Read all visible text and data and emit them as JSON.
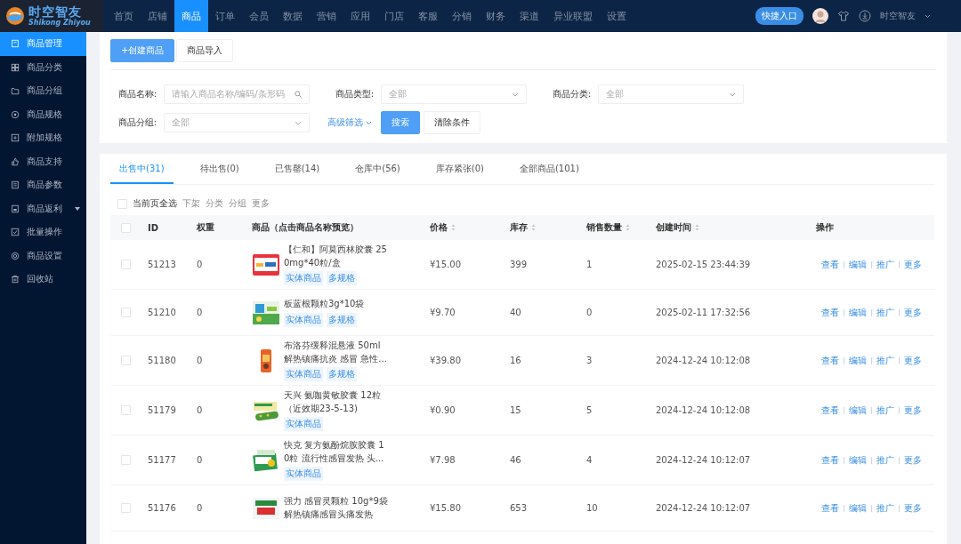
{
  "brand": {
    "name": "时空智友",
    "subtitle": "Shikong Zhiyou"
  },
  "nav": [
    {
      "label": "首页",
      "selected": false
    },
    {
      "label": "店铺",
      "selected": false
    },
    {
      "label": "商品",
      "selected": true
    },
    {
      "label": "订单",
      "selected": false
    },
    {
      "label": "会员",
      "selected": false
    },
    {
      "label": "数据",
      "selected": false
    },
    {
      "label": "营销",
      "selected": false
    },
    {
      "label": "应用",
      "selected": false
    },
    {
      "label": "门店",
      "selected": false
    },
    {
      "label": "客服",
      "selected": false
    },
    {
      "label": "分销",
      "selected": false
    },
    {
      "label": "财务",
      "selected": false
    },
    {
      "label": "渠道",
      "selected": false
    },
    {
      "label": "异业联盟",
      "selected": false
    },
    {
      "label": "设置",
      "selected": false
    }
  ],
  "header_right": {
    "quick_button": "快捷入口",
    "user": "时空智友"
  },
  "sidebar": [
    {
      "label": "商品管理",
      "selected": true,
      "has_submenu": false
    },
    {
      "label": "商品分类",
      "selected": false,
      "has_submenu": false
    },
    {
      "label": "商品分组",
      "selected": false,
      "has_submenu": false
    },
    {
      "label": "商品规格",
      "selected": false,
      "has_submenu": false
    },
    {
      "label": "附加规格",
      "selected": false,
      "has_submenu": false
    },
    {
      "label": "商品支持",
      "selected": false,
      "has_submenu": false
    },
    {
      "label": "商品参数",
      "selected": false,
      "has_submenu": false
    },
    {
      "label": "商品返利",
      "selected": false,
      "has_submenu": true
    },
    {
      "label": "批量操作",
      "selected": false,
      "has_submenu": false
    },
    {
      "label": "商品设置",
      "selected": false,
      "has_submenu": false
    },
    {
      "label": "回收站",
      "selected": false,
      "has_submenu": false
    }
  ],
  "toolbar": [
    {
      "label": "+创建商品",
      "kind": "primary"
    },
    {
      "label": "商品导入",
      "kind": "default"
    }
  ],
  "filters": [
    {
      "label": "商品名称:",
      "kind": "search",
      "placeholder": "请输入商品名称/编码/条形码"
    },
    {
      "label": "商品类型:",
      "kind": "select",
      "value": "全部"
    },
    {
      "label": "商品分类:",
      "kind": "select",
      "value": "全部"
    },
    {
      "label": "商品分组:",
      "kind": "select",
      "value": "全部"
    }
  ],
  "filter_actions": {
    "advanced": "高级筛选",
    "search": "搜索",
    "clear": "清除条件"
  },
  "tabs": [
    {
      "label": "出售中(31)",
      "selected": true
    },
    {
      "label": "待出售(0)",
      "selected": false
    },
    {
      "label": "已售罄(14)",
      "selected": false
    },
    {
      "label": "仓库中(56)",
      "selected": false
    },
    {
      "label": "库存紧张(0)",
      "selected": false
    },
    {
      "label": "全部商品(101)",
      "selected": false
    }
  ],
  "bulk": {
    "select_all": "当前页全选",
    "checked": false,
    "actions": [
      {
        "label": "下架",
        "disabled": true
      },
      {
        "label": "分类",
        "disabled": true
      },
      {
        "label": "分组",
        "disabled": true
      },
      {
        "label": "更多",
        "disabled": true
      }
    ]
  },
  "table": {
    "header_checked": false,
    "columns": [
      {
        "label": "ID",
        "sortable": false
      },
      {
        "label": "权重",
        "sortable": false
      },
      {
        "label": "商品（点击商品名称预览）",
        "sortable": false
      },
      {
        "label": "价格",
        "sortable": true
      },
      {
        "label": "库存",
        "sortable": true
      },
      {
        "label": "销售数量",
        "sortable": true
      },
      {
        "label": "创建时间",
        "sortable": true
      },
      {
        "label": "操作",
        "sortable": false
      }
    ],
    "rows": [
      {
        "checked": false,
        "id": "51213",
        "weight": "0",
        "name": "【仁和】阿莫西林胶囊 250mg*40粒/盒",
        "tags": [
          "实体商品",
          "多规格"
        ],
        "price": "¥15.00",
        "stock": "399",
        "sales": "1",
        "created": "2025-02-15 23:44:39",
        "actions": [
          "查看",
          "编辑",
          "推广",
          "更多"
        ]
      },
      {
        "checked": false,
        "id": "51210",
        "weight": "0",
        "name": "板蓝根颗粒3g*10袋",
        "tags": [
          "实体商品",
          "多规格"
        ],
        "price": "¥9.70",
        "stock": "40",
        "sales": "0",
        "created": "2025-02-11 17:32:56",
        "actions": [
          "查看",
          "编辑",
          "推广",
          "更多"
        ]
      },
      {
        "checked": false,
        "id": "51180",
        "weight": "0",
        "name": "布洛芬缓释混悬液 50ml 解热镇痛抗炎 感冒 急性...",
        "tags": [
          "实体商品",
          "多规格"
        ],
        "price": "¥39.80",
        "stock": "16",
        "sales": "3",
        "created": "2024-12-24 10:12:08",
        "actions": [
          "查看",
          "编辑",
          "推广",
          "更多"
        ]
      },
      {
        "checked": false,
        "id": "51179",
        "weight": "0",
        "name": "天兴 氨咖黄敏胶囊 12粒（近效期23-5-13)",
        "tags": [
          "实体商品"
        ],
        "price": "¥0.90",
        "stock": "15",
        "sales": "5",
        "created": "2024-12-24 10:12:08",
        "actions": [
          "查看",
          "编辑",
          "推广",
          "更多"
        ]
      },
      {
        "checked": false,
        "id": "51177",
        "weight": "0",
        "name": "快克 复方氨酚烷胺胶囊 10粒 流行性感冒发热 头...",
        "tags": [
          "实体商品"
        ],
        "price": "¥7.98",
        "stock": "46",
        "sales": "4",
        "created": "2024-12-24 10:12:07",
        "actions": [
          "查看",
          "编辑",
          "推广",
          "更多"
        ]
      },
      {
        "checked": false,
        "id": "51176",
        "weight": "0",
        "name": "强力 感冒灵颗粒 10g*9袋解热镇痛感冒头痛发热",
        "tags": [],
        "price": "¥15.80",
        "stock": "653",
        "sales": "10",
        "created": "2024-12-24 10:12:07",
        "actions": [
          "查看",
          "编辑",
          "推广",
          "更多"
        ]
      }
    ]
  }
}
